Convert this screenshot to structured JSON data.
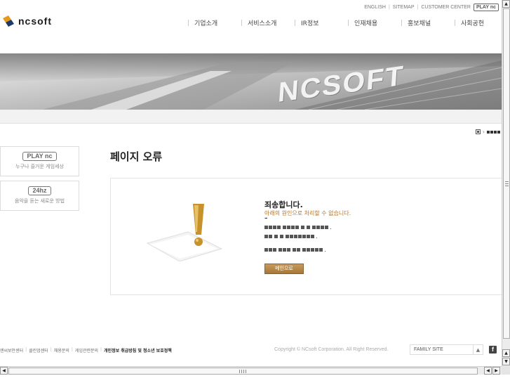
{
  "header": {
    "util_links": [
      "ENGLISH",
      "SITEMAP",
      "CUSTOMER CENTER"
    ],
    "play_badge": "PLAY nc",
    "logo_text": "ncsoft",
    "nav": [
      "기업소개",
      "서비스소개",
      "IR정보",
      "인재채용",
      "홍보채널",
      "사회공헌"
    ]
  },
  "banner": {
    "brand_text": "NCSOFT"
  },
  "sidebar": {
    "boxes": [
      {
        "badge": "PLAY nc",
        "caption": "누구나 즐거운 게임세상"
      },
      {
        "badge": "24hz",
        "caption": "음악을 듣는 새로운 방법"
      }
    ]
  },
  "main": {
    "page_title": "페이지 오류",
    "error_heading": "죄송합니다.",
    "error_sub": "아래의 원인으로 처리할 수 없습니다.",
    "error_dash": "–",
    "main_button": "메인으로"
  },
  "footer": {
    "links": [
      "엔씨보안센터",
      "클린업센터",
      "채용문의",
      "게임관련문의",
      "개인정보 취급방침 및 청소년 보호정책"
    ],
    "copyright": "Copyright © NCsoft Corporation. All Right Reserved.",
    "family_site": "FAMILY SITE",
    "facebook": "f"
  },
  "colors": {
    "accent": "#b5742b",
    "button": "#a77736"
  },
  "icons": [
    "logo-mark-icon",
    "home-icon",
    "exclamation-icon",
    "facebook-icon",
    "scroll-arrow-icon"
  ]
}
